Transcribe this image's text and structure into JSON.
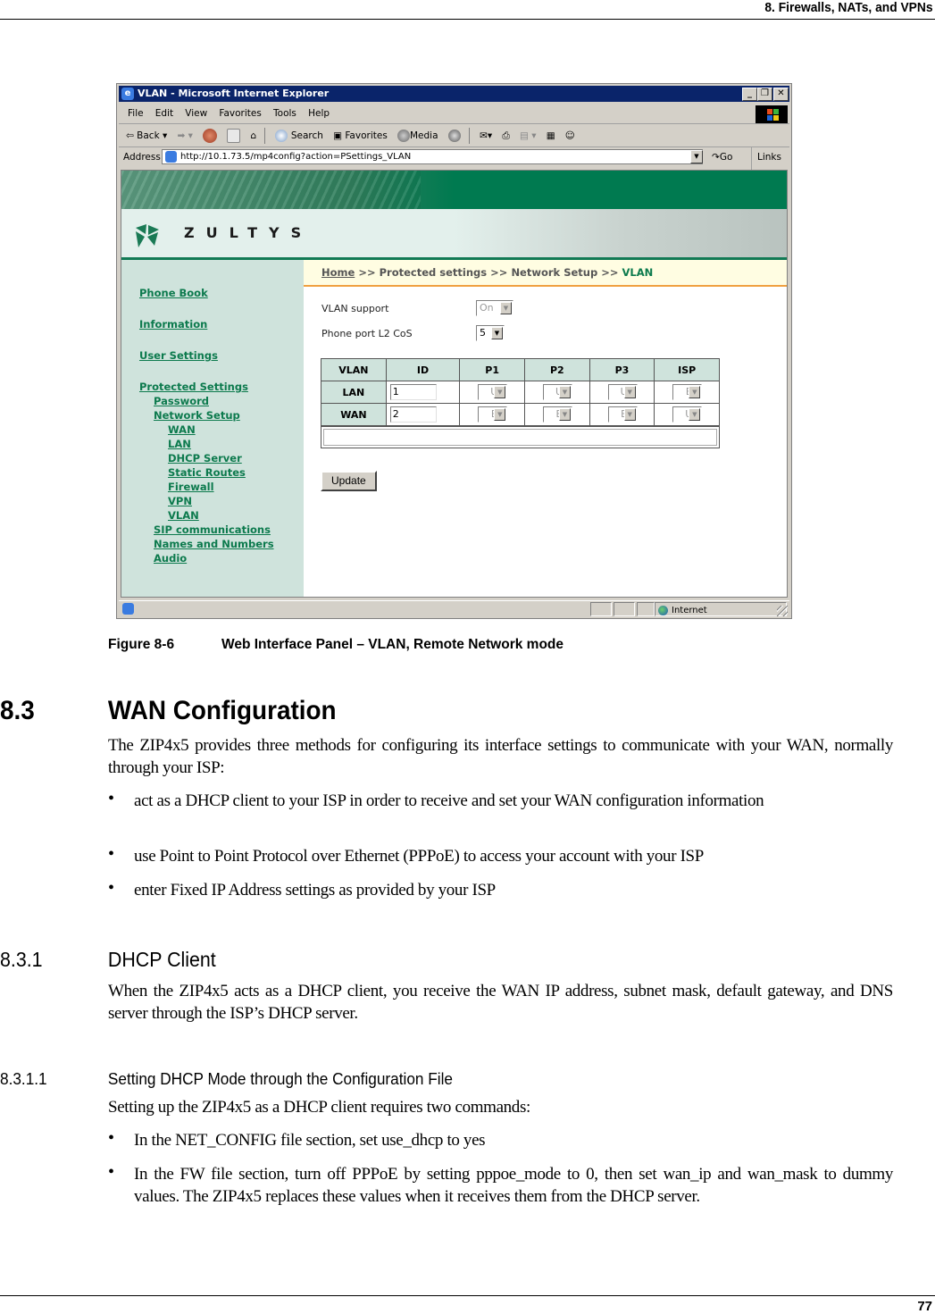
{
  "page": {
    "running_header": "8. Firewalls, NATs, and VPNs",
    "page_number": "77"
  },
  "browser": {
    "title": "VLAN - Microsoft Internet Explorer",
    "window_buttons": {
      "minimize": "_",
      "restore": "❐",
      "close": "✕"
    },
    "menu": [
      "File",
      "Edit",
      "View",
      "Favorites",
      "Tools",
      "Help"
    ],
    "toolbar": {
      "back": "Back",
      "search": "Search",
      "favorites": "Favorites",
      "media": "Media"
    },
    "address_label": "Address",
    "url": "http://10.1.73.5/mp4config?action=PSettings_VLAN",
    "go_label": "Go",
    "links_label": "Links",
    "status_zone": "Internet"
  },
  "webpage": {
    "logo_text": "ZULTYS",
    "sidebar": [
      {
        "label": "Phone Book",
        "level": 0
      },
      {
        "label": "Information",
        "level": 0
      },
      {
        "label": "User Settings",
        "level": 0
      },
      {
        "label": "Protected Settings",
        "level": 0
      },
      {
        "label": "Password",
        "level": 1
      },
      {
        "label": "Network Setup",
        "level": 1
      },
      {
        "label": "WAN",
        "level": 2
      },
      {
        "label": "LAN",
        "level": 2
      },
      {
        "label": "DHCP Server",
        "level": 2
      },
      {
        "label": "Static Routes",
        "level": 2
      },
      {
        "label": "Firewall",
        "level": 2
      },
      {
        "label": "VPN",
        "level": 2
      },
      {
        "label": "VLAN",
        "level": 2
      },
      {
        "label": "SIP communications",
        "level": 1
      },
      {
        "label": "Names and Numbers",
        "level": 1
      },
      {
        "label": "Audio",
        "level": 1
      }
    ],
    "breadcrumb": {
      "home": "Home",
      "sep": ">>",
      "protected": "Protected settings",
      "network": "Network Setup",
      "current": "VLAN"
    },
    "fields": {
      "vlan_support_label": "VLAN support",
      "vlan_support_value": "On",
      "l2cos_label": "Phone port L2 CoS",
      "l2cos_value": "5"
    },
    "table": {
      "headers": [
        "VLAN",
        "ID",
        "P1",
        "P2",
        "P3",
        "ISP"
      ],
      "rows": [
        {
          "name": "LAN",
          "id": "1",
          "p1": "U",
          "p2": "U",
          "p3": "U",
          "isp": "E"
        },
        {
          "name": "WAN",
          "id": "2",
          "p1": "E",
          "p2": "E",
          "p3": "E",
          "isp": "U"
        }
      ]
    },
    "update_button": "Update"
  },
  "figure_caption": {
    "number": "Figure 8-6",
    "text": "Web Interface Panel – VLAN, Remote Network mode"
  },
  "sections": {
    "s83": {
      "number": "8.3",
      "title": "WAN Configuration",
      "intro": "The ZIP4x5 provides three methods for configuring its interface settings to communicate with your WAN, normally through your ISP:",
      "bullets": [
        "act as a DHCP client to your ISP in order to receive and set your WAN configuration information",
        "use Point to Point Protocol over Ethernet (PPPoE) to access your account with your ISP",
        "enter Fixed IP Address settings as provided by your ISP"
      ]
    },
    "s831": {
      "number": "8.3.1",
      "title": "DHCP Client",
      "body": "When the ZIP4x5 acts as a DHCP client, you receive the WAN IP address, subnet mask, default gateway, and DNS server through the ISP’s DHCP server."
    },
    "s8311": {
      "number": "8.3.1.1",
      "title": "Setting DHCP Mode through the Configuration File",
      "intro": "Setting up the ZIP4x5 as a DHCP client requires two commands:",
      "bullets": [
        "In the NET_CONFIG file section, set use_dhcp to yes",
        "In the FW file section, turn off PPPoE by setting pppoe_mode to 0, then set wan_ip and wan_mask to dummy values. The ZIP4x5 replaces these values when it receives them from the DHCP server."
      ]
    }
  }
}
